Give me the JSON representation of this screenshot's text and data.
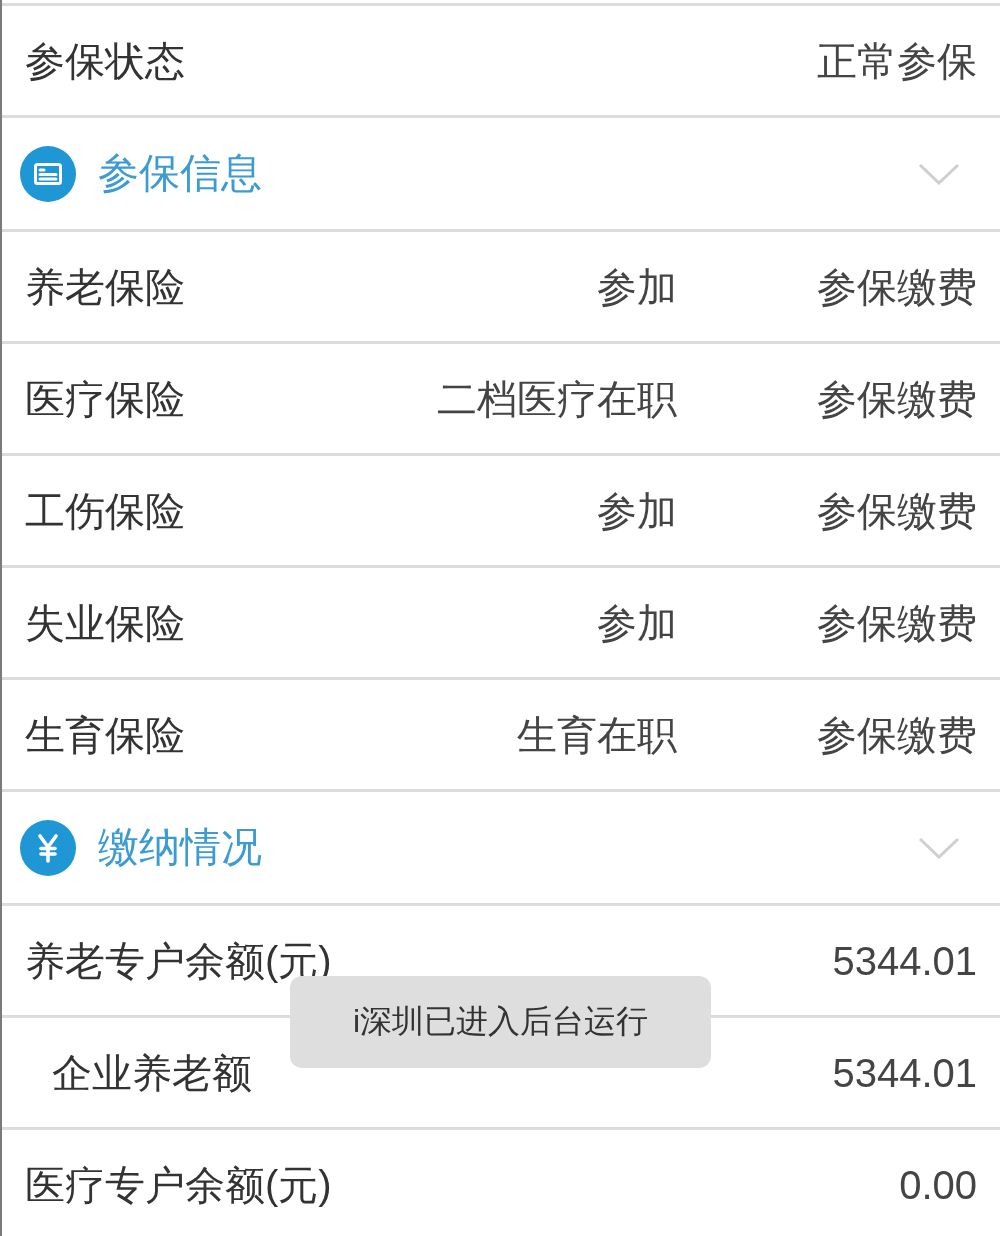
{
  "status_row": {
    "label": "参保状态",
    "value": "正常参保"
  },
  "sections": [
    {
      "kind": "insurance",
      "title": "参保信息",
      "rows": [
        {
          "name": "养老保险",
          "status": "参加",
          "payment": "参保缴费"
        },
        {
          "name": "医疗保险",
          "status": "二档医疗在职",
          "payment": "参保缴费"
        },
        {
          "name": "工伤保险",
          "status": "参加",
          "payment": "参保缴费"
        },
        {
          "name": "失业保险",
          "status": "参加",
          "payment": "参保缴费"
        },
        {
          "name": "生育保险",
          "status": "生育在职",
          "payment": "参保缴费"
        }
      ]
    },
    {
      "kind": "payment",
      "title": "缴纳情况",
      "rows": [
        {
          "label": "养老专户余额(元)",
          "amount": "5344.01",
          "children": [
            {
              "label": "企业养老额",
              "amount": "5344.01"
            }
          ]
        },
        {
          "label": "医疗专户余额(元)",
          "amount": "0.00"
        }
      ]
    }
  ],
  "toast": {
    "text": "i深圳已进入后台运行"
  }
}
